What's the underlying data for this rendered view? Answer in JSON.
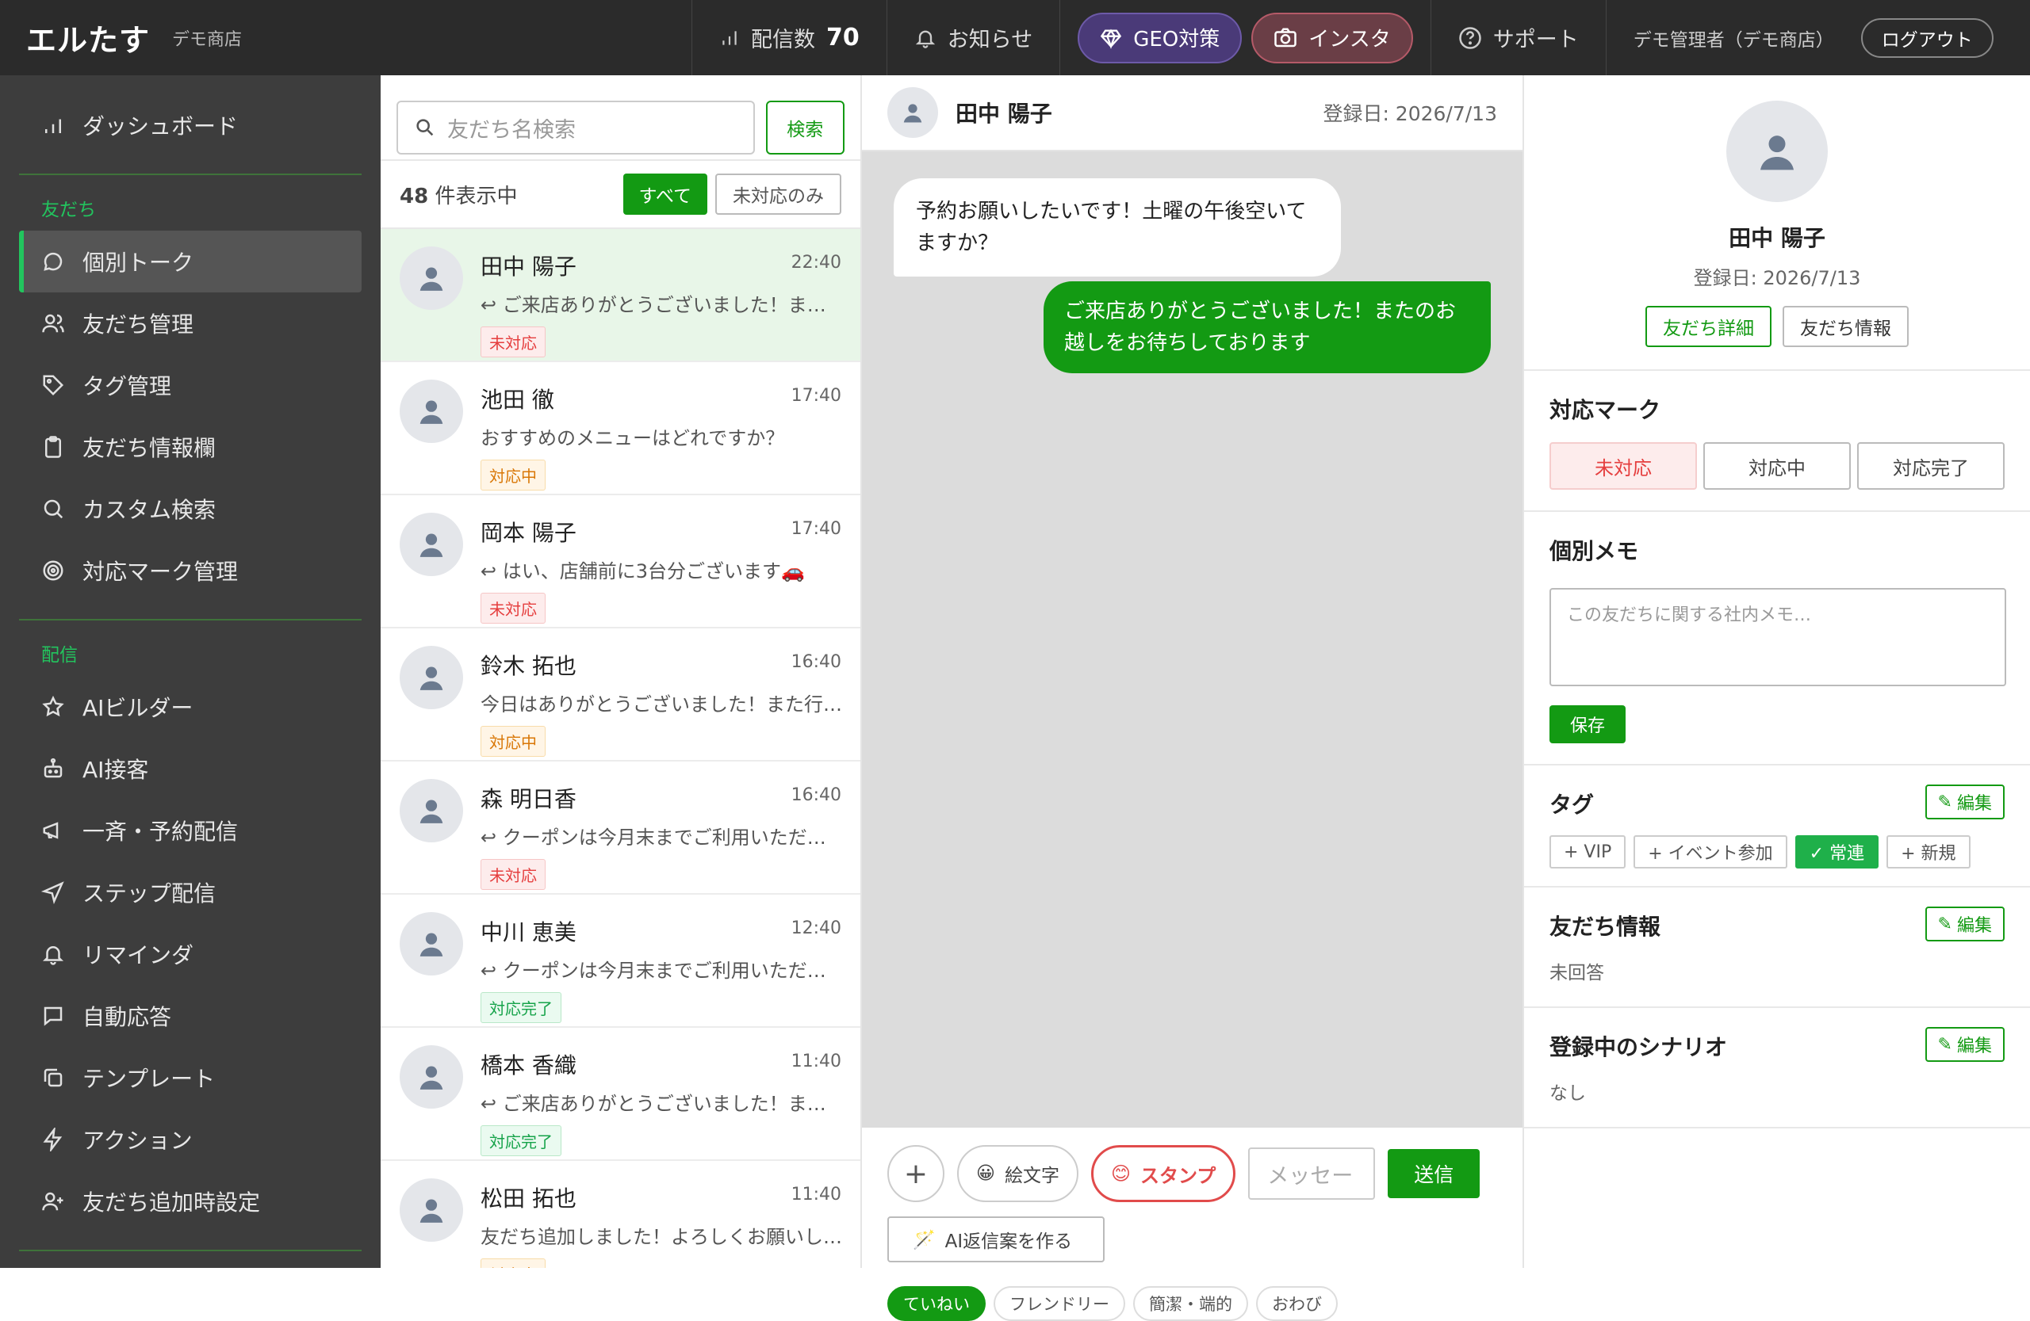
{
  "header": {
    "brand": "エルたす",
    "store": "デモ商店",
    "delivery_label": "配信数",
    "delivery_count": "70",
    "news": "お知らせ",
    "geo": "GEO対策",
    "insta": "インスタ",
    "support": "サポート",
    "admin": "デモ管理者（デモ商店）",
    "logout": "ログアウト"
  },
  "sidebar": {
    "dashboard": "ダッシュボード",
    "friends_head": "友だち",
    "friends": [
      "個別トーク",
      "友だち管理",
      "タグ管理",
      "友だち情報欄",
      "カスタム検索",
      "対応マーク管理"
    ],
    "delivery_head": "配信",
    "delivery": [
      "AIビルダー",
      "AI接客",
      "一斉・予約配信",
      "ステップ配信",
      "リマインダ",
      "自動応答",
      "テンプレート",
      "アクション",
      "友だち追加時設定"
    ]
  },
  "list": {
    "search_placeholder": "友だち名検索",
    "search_button": "検索",
    "count": "48",
    "count_suffix": "件表示中",
    "filter_all": "すべて",
    "filter_unhandled": "未対応のみ",
    "rows": [
      {
        "name": "田中 陽子",
        "time": "22:40",
        "msg": "↩ ご来店ありがとうございました！またのお越しを",
        "badge": "未対応"
      },
      {
        "name": "池田 徹",
        "time": "17:40",
        "msg": "おすすめのメニューはどれですか？",
        "badge": "対応中"
      },
      {
        "name": "岡本 陽子",
        "time": "17:40",
        "msg": "↩ はい、店舗前に3台分ございます🚗",
        "badge": "未対応"
      },
      {
        "name": "鈴木 拓也",
        "time": "16:40",
        "msg": "今日はありがとうございました！また行きます",
        "badge": "対応中"
      },
      {
        "name": "森 明日香",
        "time": "16:40",
        "msg": "↩ クーポンは今月末までご利用いただけます",
        "badge": "未対応"
      },
      {
        "name": "中川 恵美",
        "time": "12:40",
        "msg": "↩ クーポンは今月末までご利用いただけます",
        "badge": "対応完了"
      },
      {
        "name": "橋本 香織",
        "time": "11:40",
        "msg": "↩ ご来店ありがとうございました！またのお越しを",
        "badge": "対応完了"
      },
      {
        "name": "松田 拓也",
        "time": "11:40",
        "msg": "友だち追加しました！よろしくお願いします",
        "badge": "対応中"
      }
    ]
  },
  "chat": {
    "name": "田中 陽子",
    "date": "登録日: 2026/7/13",
    "msg_in": "予約お願いしたいです！土曜の午後空いてますか？",
    "msg_out": "ご来店ありがとうございました！またのお越しをお待ちしております",
    "emoji": "絵文字",
    "stamp": "スタンプ",
    "placeholder": "メッセー",
    "send": "送信",
    "ai": "AI返信案を作る",
    "tones": [
      "ていねい",
      "フレンドリー",
      "簡潔・端的",
      "おわび"
    ]
  },
  "profile": {
    "name": "田中 陽子",
    "date": "登録日: 2026/7/13",
    "btn_detail": "友だち詳細",
    "btn_info": "友だち情報",
    "mark_title": "対応マーク",
    "marks": [
      "未対応",
      "対応中",
      "対応完了"
    ],
    "memo_title": "個別メモ",
    "memo_placeholder": "この友だちに関する社内メモ…",
    "save": "保存",
    "tag_title": "タグ",
    "edit": "編集",
    "tags": [
      "+ VIP",
      "+ イベント参加",
      "✓ 常連",
      "+ 新規"
    ],
    "info_title": "友だち情報",
    "info_value": "未回答",
    "scenario_title": "登録中のシナリオ",
    "scenario_value": "なし"
  }
}
